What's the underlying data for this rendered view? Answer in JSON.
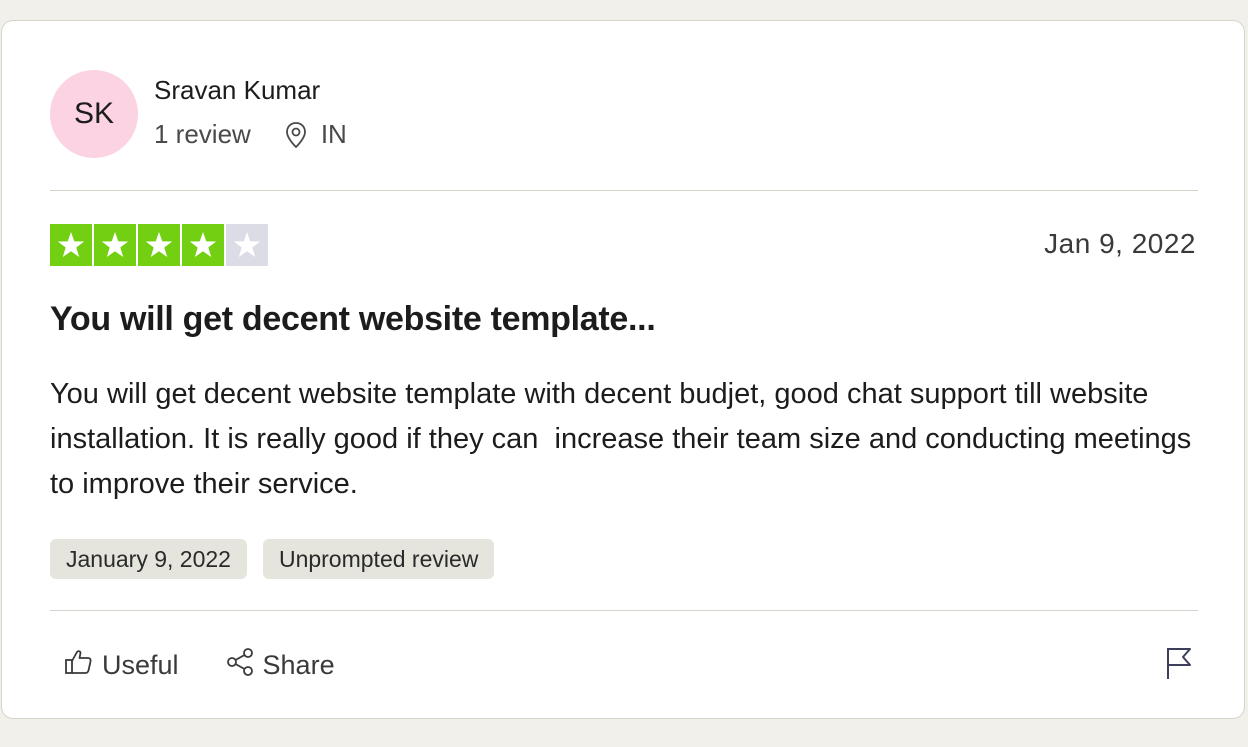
{
  "reviewer": {
    "initials": "SK",
    "name": "Sravan Kumar",
    "review_count": "1 review",
    "country": "IN",
    "avatar_color": "#fcd3e2"
  },
  "rating": {
    "value": 4,
    "max": 5,
    "filled_color": "#73cf11",
    "empty_color": "#dcdce6"
  },
  "review": {
    "date": "Jan 9, 2022",
    "title": "You will get decent website template...",
    "body": "You will get decent website template with decent budjet, good chat support till website installation. It is really good if they can  increase their team size and conducting meetings to improve their service."
  },
  "tags": [
    {
      "label": "January 9, 2022"
    },
    {
      "label": "Unprompted review"
    }
  ],
  "actions": {
    "useful_label": "Useful",
    "useful_icon": "thumbs-up-icon",
    "share_label": "Share",
    "share_icon": "share-icon",
    "report_icon": "flag-icon"
  }
}
